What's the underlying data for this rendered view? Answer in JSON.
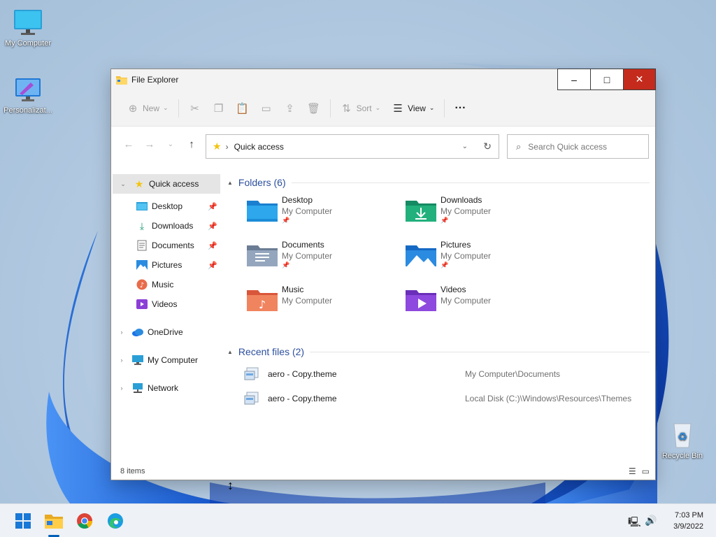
{
  "desktop": {
    "icons": [
      {
        "label": "My Computer"
      },
      {
        "label": "Personalizat..."
      },
      {
        "label": "Recycle Bin"
      }
    ]
  },
  "window": {
    "title": "File Explorer",
    "buttons": {
      "minimize": "–",
      "maximize": "□",
      "close": "✕"
    }
  },
  "toolbar": {
    "new_label": "New",
    "sort_label": "Sort",
    "view_label": "View",
    "more_label": "···"
  },
  "address": {
    "path": "Quick access",
    "search_placeholder": "Search Quick access"
  },
  "nav": {
    "quick_access": "Quick access",
    "items": [
      {
        "label": "Desktop",
        "pinned": true
      },
      {
        "label": "Downloads",
        "pinned": true
      },
      {
        "label": "Documents",
        "pinned": true
      },
      {
        "label": "Pictures",
        "pinned": true
      },
      {
        "label": "Music",
        "pinned": false
      },
      {
        "label": "Videos",
        "pinned": false
      }
    ],
    "onedrive": "OneDrive",
    "my_computer": "My Computer",
    "network": "Network"
  },
  "content": {
    "folders_header": "Folders (6)",
    "folders": [
      {
        "name": "Desktop",
        "location": "My Computer",
        "pinned": true
      },
      {
        "name": "Downloads",
        "location": "My Computer",
        "pinned": true
      },
      {
        "name": "Documents",
        "location": "My Computer",
        "pinned": true
      },
      {
        "name": "Pictures",
        "location": "My Computer",
        "pinned": true
      },
      {
        "name": "Music",
        "location": "My Computer",
        "pinned": false
      },
      {
        "name": "Videos",
        "location": "My Computer",
        "pinned": false
      }
    ],
    "recent_header": "Recent files (2)",
    "recent": [
      {
        "name": "aero - Copy.theme",
        "path": "My Computer\\Documents"
      },
      {
        "name": "aero - Copy.theme",
        "path": "Local Disk (C:)\\Windows\\Resources\\Themes"
      }
    ]
  },
  "status": {
    "count": "8 items"
  },
  "taskbar": {
    "time": "7:03 PM",
    "date": "3/9/2022"
  },
  "colors": {
    "accent": "#005fb8",
    "close_red": "#c42b1c",
    "section_blue": "#2c4f9e"
  }
}
